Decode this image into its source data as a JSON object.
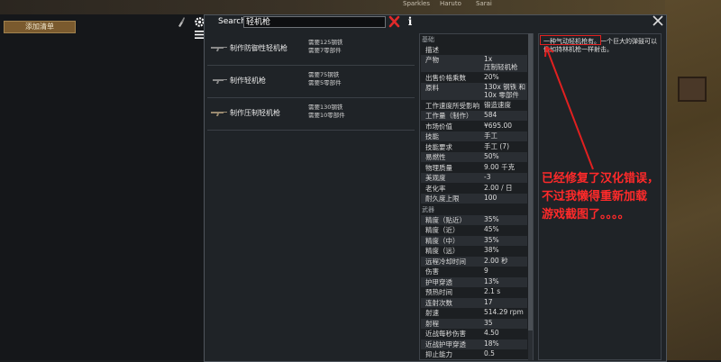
{
  "top_bar": {
    "pawns": [
      "Sparkles",
      "Haruto",
      "Sarai"
    ]
  },
  "left_panel": {
    "add_bill_label": "添加清单"
  },
  "search": {
    "label": "Search",
    "value": "轻机枪"
  },
  "info_button_label": "i",
  "recipes": [
    {
      "name": "制作防御性轻机枪",
      "req1": "需要125钢铁",
      "req2": "需要7零部件"
    },
    {
      "name": "制作轻机枪",
      "req1": "需要75钢铁",
      "req2": "需要5零部件"
    },
    {
      "name": "制作压制轻机枪",
      "req1": "需要130钢铁",
      "req2": "需要10零部件"
    }
  ],
  "stats": {
    "basic_header": "基础",
    "desc_row": "描述",
    "rows_basic": [
      {
        "k": "产物",
        "v": "1x\n压制轻机枪"
      },
      {
        "k": "出售价格乘数",
        "v": "20%"
      },
      {
        "k": "原料",
        "v": "130x 钢铁 和\n10x 零部件"
      },
      {
        "k": "工作速度所受影响",
        "v": "锻造速度"
      },
      {
        "k": "工作量（制作）",
        "v": "584"
      },
      {
        "k": "市场价值",
        "v": "¥695.00"
      },
      {
        "k": "技能",
        "v": "手工"
      },
      {
        "k": "技能要求",
        "v": "手工 (7)"
      },
      {
        "k": "易燃性",
        "v": "50%"
      },
      {
        "k": "物理质量",
        "v": "9.00 千克"
      },
      {
        "k": "美观度",
        "v": "-3"
      },
      {
        "k": "老化率",
        "v": "2.00 / 日"
      },
      {
        "k": "耐久度上限",
        "v": "100"
      }
    ],
    "weapon_header": "武器",
    "rows_weapon": [
      {
        "k": "精度（贴近）",
        "v": "35%"
      },
      {
        "k": "精度（近）",
        "v": "45%"
      },
      {
        "k": "精度（中）",
        "v": "35%"
      },
      {
        "k": "精度（远）",
        "v": "38%"
      },
      {
        "k": "远程冷却时间",
        "v": "2.00 秒"
      },
      {
        "k": "伤害",
        "v": "9"
      },
      {
        "k": "护甲穿透",
        "v": "13%"
      },
      {
        "k": "预热时间",
        "v": "2.1 s"
      },
      {
        "k": "连射次数",
        "v": "17"
      },
      {
        "k": "射速",
        "v": "514.29 rpm"
      },
      {
        "k": "射程",
        "v": "35"
      },
      {
        "k": "近战每秒伤害",
        "v": "4.50"
      },
      {
        "k": "近战护甲穿透",
        "v": "18%"
      },
      {
        "k": "抑止能力",
        "v": "0.5"
      }
    ]
  },
  "description": {
    "highlight": "一种气动轻机枪有",
    "text": "一种气动轻机枪有。一个巨大的弹鼓可以像如持林机枪一样射击。"
  },
  "annotation": "已经修复了汉化错误，\n不过我懒得重新加载\n游戏截图了。。。。",
  "colors": {
    "accent_red": "#ff2a2a",
    "button_brown": "#7a5a2e",
    "panel_bg": "#1f2327"
  },
  "icons": [
    "brush-icon",
    "gear-icon",
    "menu-icon",
    "clear-icon",
    "info-icon",
    "close-icon",
    "rifle-icon"
  ]
}
